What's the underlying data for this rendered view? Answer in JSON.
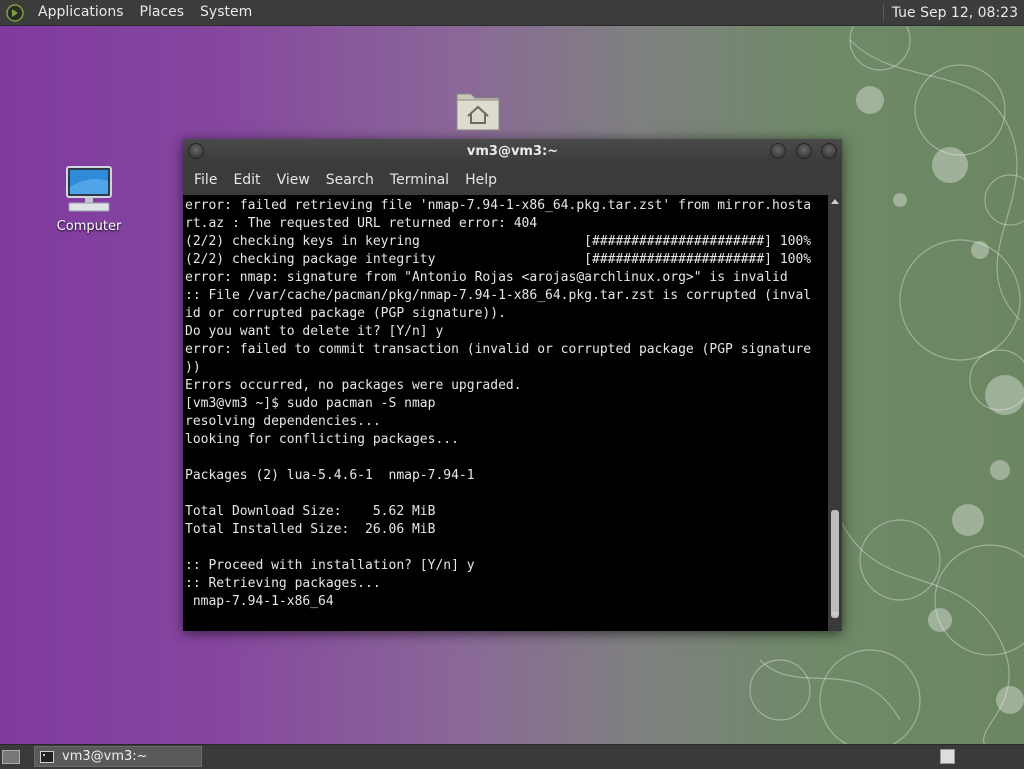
{
  "top_panel": {
    "menus": [
      "Applications",
      "Places",
      "System"
    ],
    "clock": "Tue Sep 12, 08:23"
  },
  "desktop": {
    "computer_label": "Computer"
  },
  "window": {
    "title": "vm3@vm3:~",
    "menu": [
      "File",
      "Edit",
      "View",
      "Search",
      "Terminal",
      "Help"
    ],
    "lines": [
      "error: failed retrieving file 'nmap-7.94-1-x86_64.pkg.tar.zst' from mirror.hosta",
      "rt.az : The requested URL returned error: 404",
      "(2/2) checking keys in keyring                     [######################] 100%",
      "(2/2) checking package integrity                   [######################] 100%",
      "error: nmap: signature from \"Antonio Rojas <arojas@archlinux.org>\" is invalid",
      ":: File /var/cache/pacman/pkg/nmap-7.94-1-x86_64.pkg.tar.zst is corrupted (inval",
      "id or corrupted package (PGP signature)).",
      "Do you want to delete it? [Y/n] y",
      "error: failed to commit transaction (invalid or corrupted package (PGP signature",
      "))",
      "Errors occurred, no packages were upgraded.",
      "[vm3@vm3 ~]$ sudo pacman -S nmap",
      "resolving dependencies...",
      "looking for conflicting packages...",
      "",
      "Packages (2) lua-5.4.6-1  nmap-7.94-1",
      "",
      "Total Download Size:    5.62 MiB",
      "Total Installed Size:  26.06 MiB",
      "",
      ":: Proceed with installation? [Y/n] y",
      ":: Retrieving packages...",
      " nmap-7.94-1-x86_64"
    ]
  },
  "taskbar": {
    "task_label": "vm3@vm3:~"
  }
}
